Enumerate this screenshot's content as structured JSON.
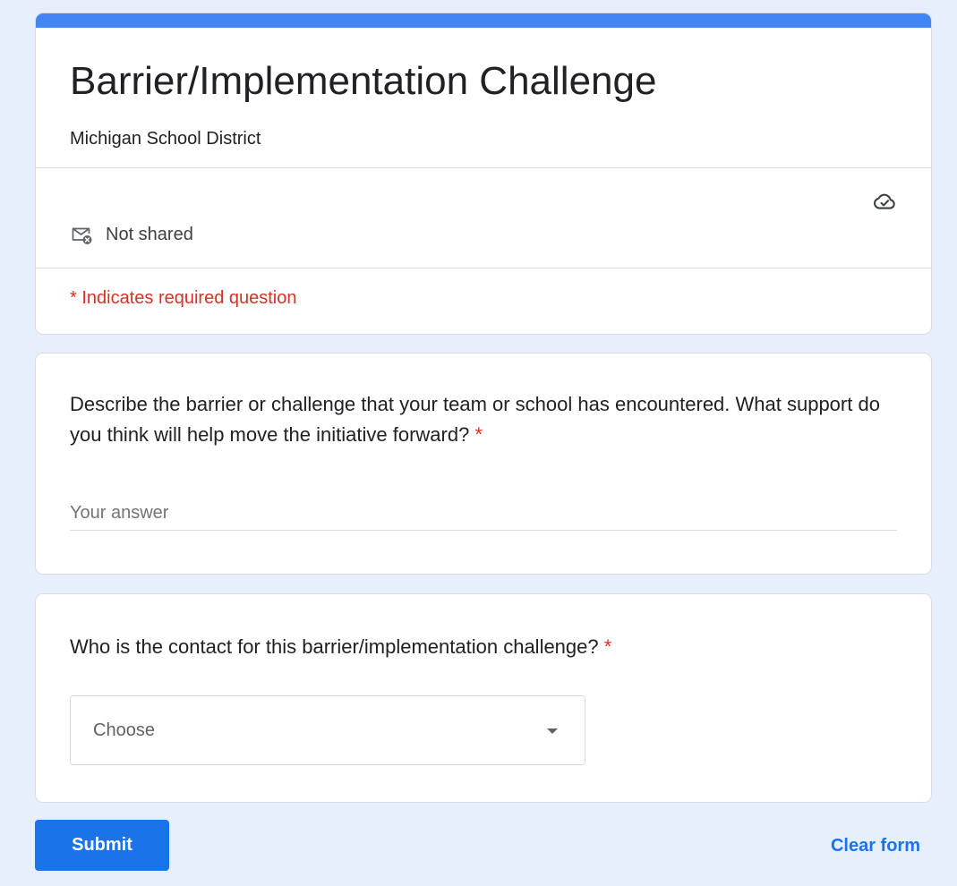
{
  "form": {
    "title": "Barrier/Implementation Challenge",
    "description": "Michigan School District",
    "share_status": "Not shared",
    "required_note": "* Indicates required question",
    "accent_color": "#4285f4"
  },
  "icons": {
    "cloud": "cloud-saved-icon",
    "mail": "mail-not-shared-icon",
    "dropdown": "caret-down-icon"
  },
  "questions": [
    {
      "text": "Describe the barrier or challenge that your team or school has encountered.  What support do you think will help move the initiative forward?",
      "required_marker": "*",
      "placeholder": "Your answer",
      "value": ""
    },
    {
      "text": "Who is the contact for this barrier/implementation challenge?",
      "required_marker": "*",
      "selected": "Choose"
    }
  ],
  "footer": {
    "submit_label": "Submit",
    "clear_label": "Clear form"
  }
}
